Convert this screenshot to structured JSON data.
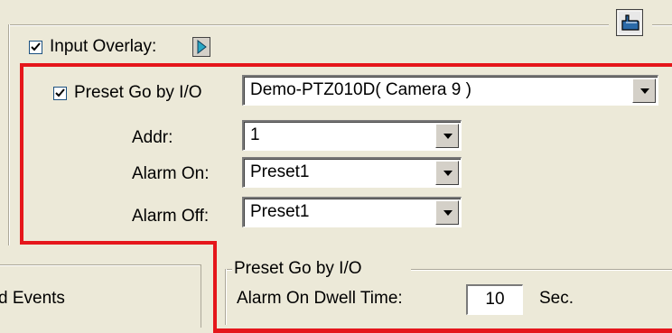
{
  "input_overlay": {
    "label": "Input Overlay:",
    "checked": true
  },
  "preset_go": {
    "label": "Preset Go by I/O",
    "checked": true,
    "camera_select": "Demo-PTZ010D( Camera 9 )",
    "addr_label": "Addr:",
    "addr_value": "1",
    "alarm_on_label": "Alarm On:",
    "alarm_on_value": "Preset1",
    "alarm_off_label": "Alarm Off:",
    "alarm_off_value": "Preset1"
  },
  "events_tab": {
    "label": "d Events"
  },
  "dwell_group": {
    "title": "Preset Go by I/O",
    "dwell_label": "Alarm On Dwell Time:",
    "dwell_value": "10",
    "unit": "Sec."
  },
  "colors": {
    "highlight": "#e5161b",
    "background": "#ece9d8"
  },
  "icons": [
    "pointing-hand-icon",
    "play-arrow-icon",
    "checkmark-icon",
    "dropdown-arrow-icon"
  ]
}
